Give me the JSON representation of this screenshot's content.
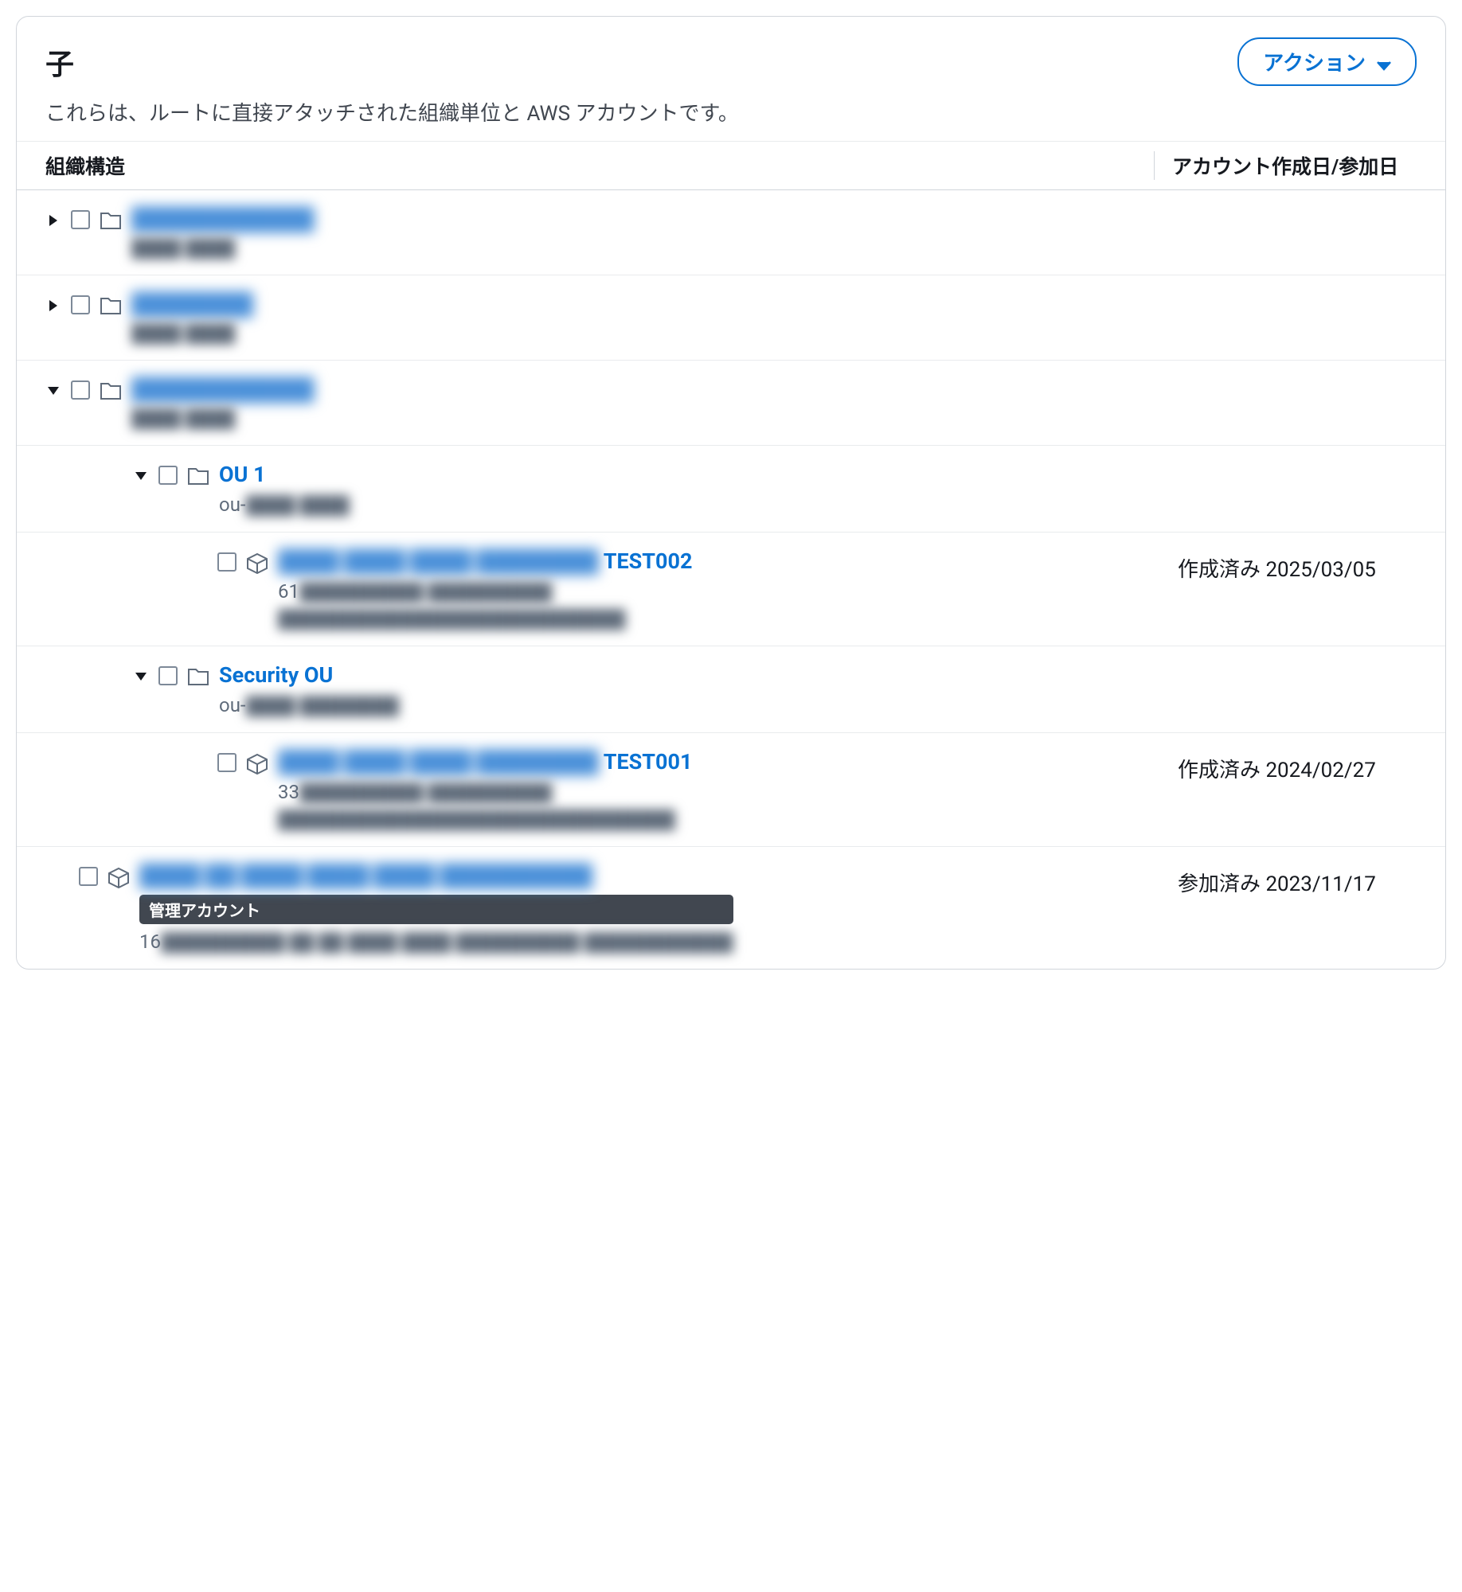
{
  "header": {
    "title": "子",
    "subtitle": "これらは、ルートに直接アタッチされた組織単位と AWS アカウントです。",
    "actions_label": "アクション"
  },
  "columns": {
    "structure": "組織構造",
    "date": "アカウント作成日/参加日"
  },
  "rows": [
    {
      "type": "ou",
      "expanded": false,
      "indent": 0,
      "name_redacted": true,
      "name_placeholder": "████████████",
      "id_redacted": "████ ████"
    },
    {
      "type": "ou",
      "expanded": false,
      "indent": 0,
      "name_redacted": true,
      "name_placeholder": "████████",
      "id_redacted": "████ ████"
    },
    {
      "type": "ou",
      "expanded": true,
      "indent": 0,
      "name_redacted": true,
      "name_placeholder": "████████████",
      "id_redacted": "████ ████"
    },
    {
      "type": "ou",
      "expanded": true,
      "indent": 1,
      "name": "OU 1",
      "id_prefix": "ou-",
      "id_redacted": "████ ████"
    },
    {
      "type": "account",
      "indent": 2,
      "name_redacted_prefix": "████ ████ ████ ████████",
      "name_suffix": "TEST002",
      "account_prefix": "61",
      "detail_redacted": "██████████   ██████████",
      "email_redacted": "████████████████████████████",
      "date": "作成済み 2025/03/05"
    },
    {
      "type": "ou",
      "expanded": true,
      "indent": 1,
      "name": "Security OU",
      "id_prefix": "ou-",
      "id_redacted": "████ ████████"
    },
    {
      "type": "account",
      "indent": 2,
      "name_redacted_prefix": "████ ████ ████ ████████",
      "name_suffix": "TEST001",
      "account_prefix": "33",
      "detail_redacted": "██████████  ██████████",
      "email_redacted": "████████████████████████████████",
      "date": "作成済み 2024/02/27"
    },
    {
      "type": "account",
      "indent": "base",
      "name_redacted_prefix": "████ ██ ████ ████ ████ ██████████",
      "management_badge": "管理アカウント",
      "account_prefix": "16",
      "detail_redacted": "██████████  ██ ██ ████ ████ ██████████ ████████████",
      "date": "参加済み 2023/11/17"
    }
  ]
}
